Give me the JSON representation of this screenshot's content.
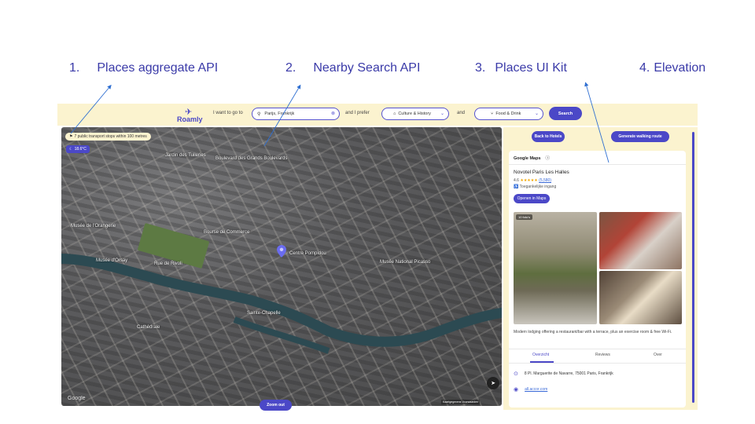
{
  "annotations": [
    {
      "num": "1.",
      "label": "Places aggregate API"
    },
    {
      "num": "2.",
      "label": "Nearby Search API"
    },
    {
      "num": "3.",
      "label": "Places UI Kit"
    },
    {
      "num": "4.",
      "label": "Elevation"
    }
  ],
  "app": {
    "logo": "Roamly",
    "topbar": {
      "prefix": "I want to go to",
      "search_value": "Parijs, Frankrijk",
      "mid_text": "and I prefer",
      "culture_select": "Culture & History",
      "and_text": "and",
      "food_select": "Food & Drink",
      "search_button": "Search"
    },
    "map": {
      "transit_chip": "7 public transport stops within 100 metres",
      "elevation_chip": "18.6°C",
      "labels": [
        "Jardin des Tuileries",
        "Boulevard des Grands Boulevards",
        "Musée de l'Orangerie",
        "Bourse de Commerce",
        "Musée d'Orsay",
        "Rue de Rivoli",
        "Centre Pompidou",
        "Musée National Picasso",
        "Sainte-Chapelle",
        "Cathédrale"
      ],
      "zoom_out": "Zoom out",
      "google_watermark": "Google",
      "attribution": "Kaartgegevens  Voorwaarden"
    },
    "sidebar": {
      "back_button": "Back to Hotels",
      "walking_button": "Generate walking route",
      "brand": "Google Maps",
      "info_icon": "info-icon",
      "hotel_name": "Novotel Paris Les Halles",
      "rating": "4.6",
      "stars": "★★★★★",
      "reviews_count": "(5,580)",
      "accessibility": "Toegankelijke ingang",
      "open_in_maps": "Openen in Maps",
      "photo_badge": "10 foto's",
      "description": "Modern lodging offering a restaurant/bar with a terrace, plus an exercise room & free Wi-Fi.",
      "tabs": [
        "Overzicht",
        "Reviews",
        "Over"
      ],
      "address": "8 Pl. Marguerite de Navarre, 75001 Paris, Frankrijk",
      "website": "all.accor.com"
    }
  },
  "colors": {
    "accent": "#4b48c7",
    "topbar_bg": "#fbf3cf",
    "annotation": "#3a3aa8"
  }
}
